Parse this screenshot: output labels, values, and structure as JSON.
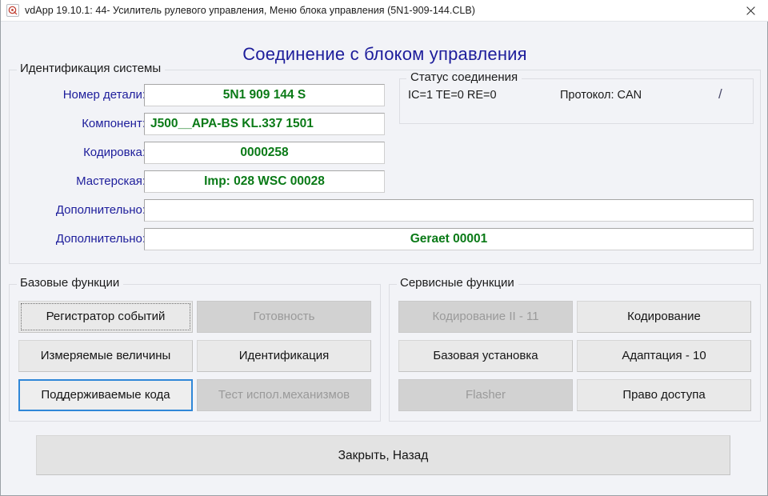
{
  "window": {
    "title": "vdApp 19.10.1: 44- Усилитель рулевого управления,  Меню блока управления (5N1-909-144.CLB)",
    "icon": "app-icon",
    "close_label": "×"
  },
  "page": {
    "heading": "Соединение с блоком управления",
    "heading_color": "#1d1d9b"
  },
  "identification": {
    "group_title": "Идентификация системы",
    "value_color": "#0a7a17",
    "label_color": "#1d1d9b",
    "rows": [
      {
        "label": "Номер детали:",
        "value": "5N1 909 144 S",
        "align": "center"
      },
      {
        "label": "Компонент:",
        "value": "J500__APA-BS KL.337 1501",
        "align": "left"
      },
      {
        "label": "Кодировка:",
        "value": "0000258",
        "align": "center"
      },
      {
        "label": "Мастерская:",
        "value": "Imp: 028     WSC 00028",
        "align": "center"
      },
      {
        "label": "Дополнительно:",
        "value": "",
        "align": "center"
      },
      {
        "label": "Дополнительно:",
        "value": "Geraet 00001",
        "align": "center"
      }
    ]
  },
  "connection_status": {
    "group_title": "Статус соединения",
    "counters": "IC=1  TE=0   RE=0",
    "protocol": "Протокол: CAN",
    "spinner": "/"
  },
  "basic_functions": {
    "group_title": "Базовые функции",
    "buttons": [
      {
        "label": "Регистратор событий",
        "enabled": true,
        "state": "focus-dotted"
      },
      {
        "label": "Готовность",
        "enabled": false,
        "state": ""
      },
      {
        "label": "Измеряемые величины",
        "enabled": true,
        "state": ""
      },
      {
        "label": "Идентификация",
        "enabled": true,
        "state": ""
      },
      {
        "label": "Поддерживаемые кода",
        "enabled": true,
        "state": "focus-blue"
      },
      {
        "label": "Тест испол.механизмов",
        "enabled": false,
        "state": ""
      }
    ]
  },
  "service_functions": {
    "group_title": "Сервисные функции",
    "buttons": [
      {
        "label": "Кодирование II - 11",
        "enabled": false,
        "state": ""
      },
      {
        "label": "Кодирование",
        "enabled": true,
        "state": ""
      },
      {
        "label": "Базовая установка",
        "enabled": true,
        "state": ""
      },
      {
        "label": "Адаптация - 10",
        "enabled": true,
        "state": ""
      },
      {
        "label": "Flasher",
        "enabled": false,
        "state": ""
      },
      {
        "label": "Право доступа",
        "enabled": true,
        "state": ""
      }
    ]
  },
  "footer": {
    "close_back_label": "Закрыть, Назад"
  }
}
